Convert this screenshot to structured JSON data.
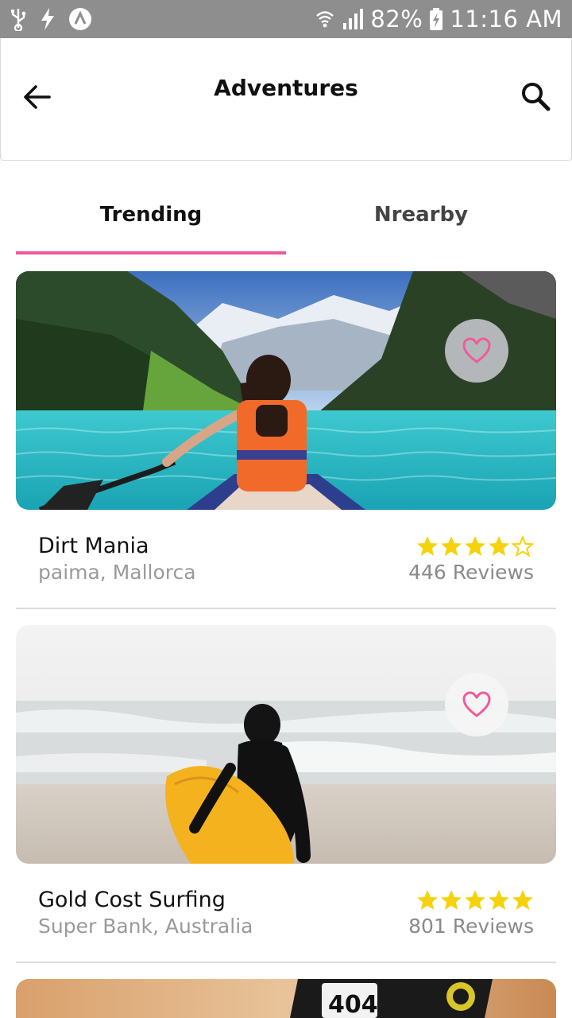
{
  "status_bar": {
    "icons_left": [
      "usb-icon",
      "flash-icon",
      "app-notification-icon"
    ],
    "battery": "82%",
    "time": "11:16 AM"
  },
  "header": {
    "title": "Adventures"
  },
  "tabs": [
    {
      "label": "Trending",
      "active": true
    },
    {
      "label": "Nrearby",
      "active": false
    }
  ],
  "colors": {
    "accent": "#ee5a9a",
    "star": "#f5d20a",
    "status_bar": "#8e8e8e"
  },
  "cards": [
    {
      "title": "Dirt Mania",
      "location": "paima, Mallorca",
      "rating": 4,
      "rating_max": 5,
      "reviews": "446 Reviews",
      "image": "kayak-lake-mountains"
    },
    {
      "title": "Gold Cost Surfing",
      "location": "Super Bank, Australia",
      "rating": 5,
      "rating_max": 5,
      "reviews": "801 Reviews",
      "image": "surfer-beach"
    },
    {
      "image": "dirt-bike-rider"
    }
  ]
}
